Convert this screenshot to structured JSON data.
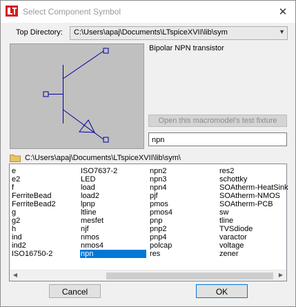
{
  "window": {
    "title": "Select Component Symbol"
  },
  "topdir": {
    "label": "Top Directory:",
    "value": "C:\\Users\\apaj\\Documents\\LTspiceXVII\\lib\\sym"
  },
  "symbol": {
    "description": "Bipolar NPN transistor",
    "open_fixture_label": "Open this macromodel's test fixture",
    "name_value": "npn"
  },
  "browser": {
    "path": "C:\\Users\\apaj\\Documents\\LTspiceXVII\\lib\\sym\\",
    "columns": [
      [
        "e",
        "e2",
        "f",
        "FerriteBead",
        "FerriteBead2",
        "g",
        "g2",
        "h",
        "ind",
        "ind2",
        "ISO16750-2"
      ],
      [
        "ISO7637-2",
        "LED",
        "load",
        "load2",
        "lpnp",
        "ltline",
        "mesfet",
        "njf",
        "nmos",
        "nmos4",
        "npn"
      ],
      [
        "npn2",
        "npn3",
        "npn4",
        "pjf",
        "pmos",
        "pmos4",
        "pnp",
        "pnp2",
        "pnp4",
        "polcap",
        "res"
      ],
      [
        "res2",
        "schottky",
        "SOAtherm-HeatSink",
        "SOAtherm-NMOS",
        "SOAtherm-PCB",
        "sw",
        "tline",
        "TVSdiode",
        "varactor",
        "voltage",
        "zener"
      ]
    ],
    "selected_item": "npn"
  },
  "buttons": {
    "cancel": "Cancel",
    "ok": "OK"
  },
  "icons": {
    "app": "ltspice-app-icon",
    "folder": "folder-icon",
    "close": "close-icon"
  },
  "colors": {
    "selection": "#0078d7",
    "symbol_stroke": "#0000a0",
    "preview_bg": "#c0c0c0"
  }
}
